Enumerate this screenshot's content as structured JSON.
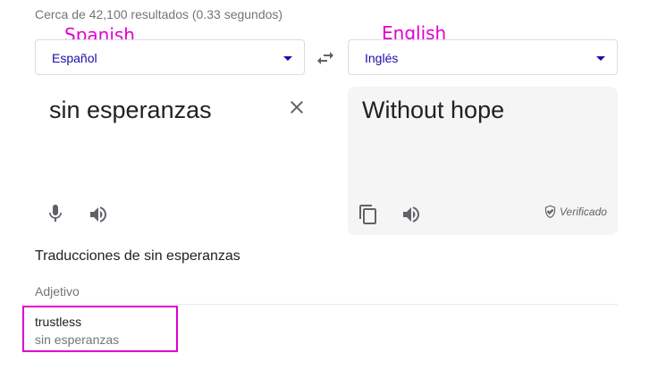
{
  "results": {
    "stats": "Cerca de 42,100 resultados (0.33 segundos)"
  },
  "annotations": {
    "source_lang": "Spanish",
    "target_lang": "English"
  },
  "translator": {
    "source_language": "Español",
    "target_language": "Inglés",
    "source_text": "sin esperanzas",
    "translated_text": "Without hope",
    "verified_label": "Verificado"
  },
  "translations": {
    "title": "Traducciones de sin esperanzas",
    "part_of_speech": "Adjetivo",
    "entries": [
      {
        "word": "trustless",
        "back_translation": "sin esperanzas"
      }
    ]
  },
  "icons": {
    "swap": "swap-arrows-icon",
    "clear": "close-icon",
    "mic": "microphone-icon",
    "speaker": "speaker-icon",
    "copy": "copy-icon",
    "verified": "shield-check-icon"
  },
  "colors": {
    "annotation": "#e000d0",
    "link": "#1a0dab",
    "muted": "#70757a"
  }
}
